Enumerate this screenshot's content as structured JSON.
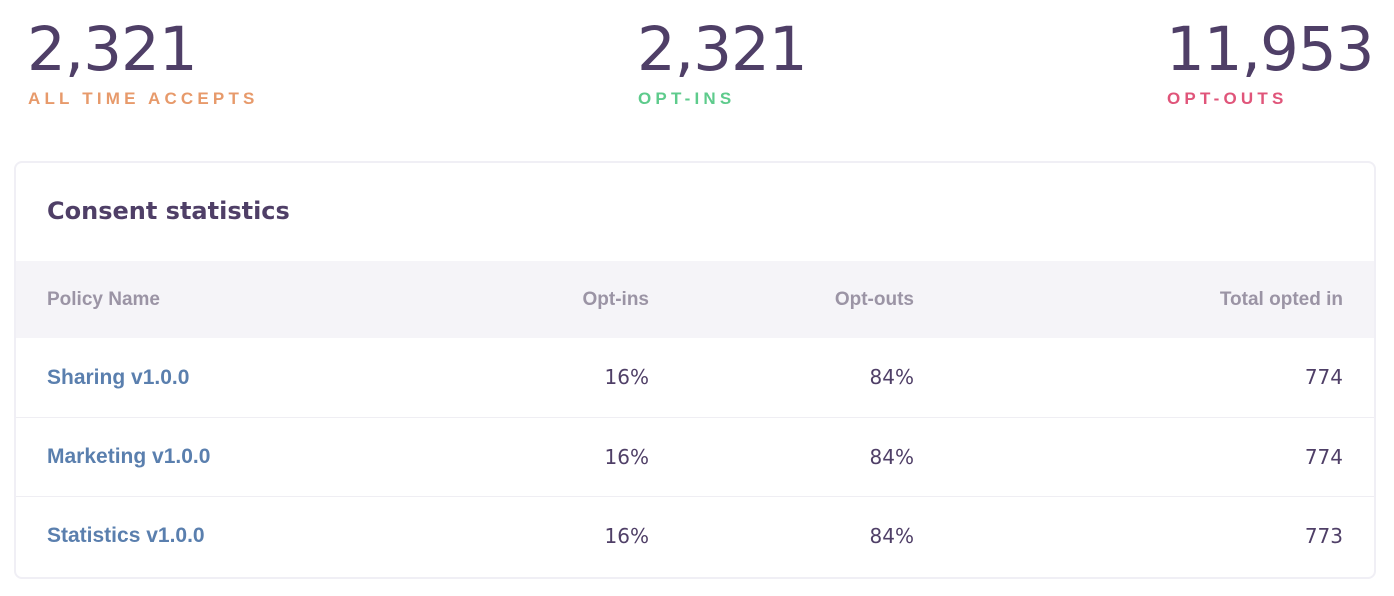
{
  "stats": [
    {
      "value": "2,321",
      "label": "ALL TIME ACCEPTS",
      "color": "#e79a6b"
    },
    {
      "value": "2,321",
      "label": "OPT-INS",
      "color": "#5ecb8c"
    },
    {
      "value": "11,953",
      "label": "OPT-OUTS",
      "color": "#e0557a"
    }
  ],
  "card": {
    "title": "Consent statistics",
    "columns": [
      "Policy Name",
      "Opt-ins",
      "Opt-outs",
      "Total opted in"
    ],
    "rows": [
      {
        "name": "Sharing v1.0.0",
        "optins": "16%",
        "optouts": "84%",
        "total": "774"
      },
      {
        "name": "Marketing v1.0.0",
        "optins": "16%",
        "optouts": "84%",
        "total": "774"
      },
      {
        "name": "Statistics v1.0.0",
        "optins": "16%",
        "optouts": "84%",
        "total": "773"
      }
    ]
  }
}
